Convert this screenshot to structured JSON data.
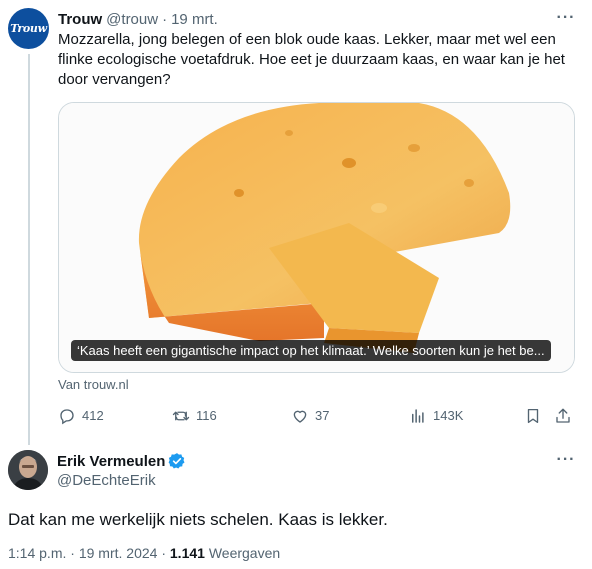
{
  "tweet1": {
    "avatar_text": "Trouw",
    "name": "Trouw",
    "handle": "@trouw",
    "separator": "·",
    "time": "19 mrt.",
    "text": "Mozzarella, jong belegen of een blok oude kaas. Lekker, maar met wel een flinke ecologische voetafdruk. Hoe eet je duurzaam kaas, en waar kan je het door vervangen?",
    "card": {
      "caption": "‘Kaas heeft een gigantische impact op het klimaat.’ Welke soorten kun je het be...",
      "source": "Van trouw.nl"
    },
    "actions": {
      "replies": "412",
      "retweets": "116",
      "likes": "37",
      "views": "143K"
    }
  },
  "tweet2": {
    "name": "Erik Vermeulen",
    "handle": "@DeEchteErik",
    "text": "Dat kan me werkelijk niets schelen. Kaas is lekker.",
    "time": "1:14 p.m.",
    "date": "19 mrt. 2024",
    "views_count": "1.141",
    "views_label": "Weergaven"
  },
  "colors": {
    "text": "#0f1419",
    "secondary": "#536471",
    "border": "#cfd9de",
    "verified": "#1d9bf0",
    "trouw_blue": "#0d4f9e"
  },
  "icons": [
    "more-icon",
    "reply-icon",
    "retweet-icon",
    "like-icon",
    "views-icon",
    "bookmark-icon",
    "share-icon",
    "verified-badge-icon"
  ]
}
